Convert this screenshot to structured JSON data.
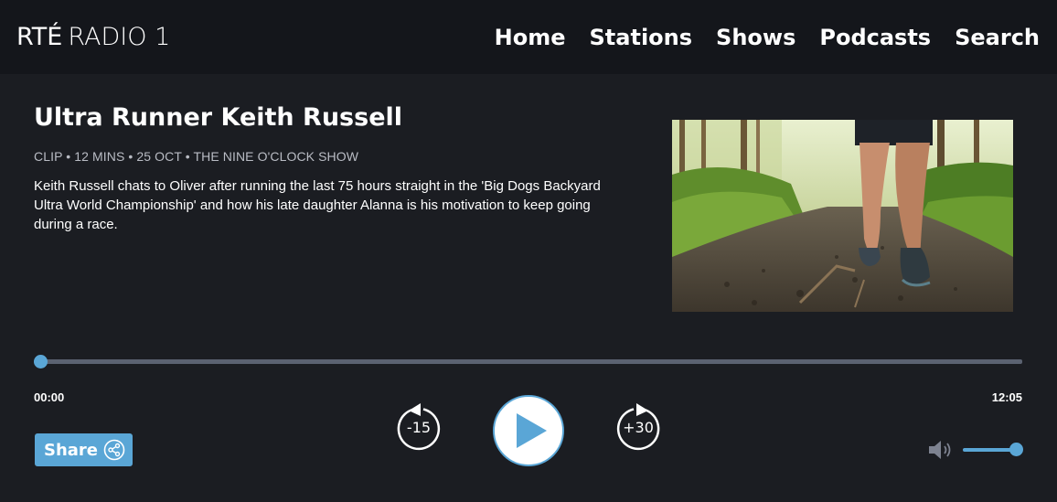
{
  "header": {
    "logo_rte": "RTÉ",
    "logo_station": "RADIO 1",
    "nav": [
      {
        "label": "Home"
      },
      {
        "label": "Stations"
      },
      {
        "label": "Shows"
      },
      {
        "label": "Podcasts"
      },
      {
        "label": "Search"
      }
    ]
  },
  "episode": {
    "title": "Ultra Runner Keith Russell",
    "meta": "CLIP • 12 MINS • 25 OCT • THE NINE O'CLOCK SHOW",
    "description": "Keith Russell chats to Oliver after running the last 75 hours straight in the 'Big Dogs Backyard Ultra World Championship' and how his late daughter Alanna is his motivation to keep going during a race.",
    "image": "trail-runner-feet-photo"
  },
  "player": {
    "current_time": "00:00",
    "total_time": "12:05",
    "progress": 0,
    "skip_back_label": "-15",
    "skip_forward_label": "+30",
    "volume": 1,
    "share_label": "Share",
    "icons": {
      "play": "play-icon",
      "skip_back": "rewind-15-icon",
      "skip_forward": "forward-30-icon",
      "volume": "speaker-icon",
      "share": "share-icon"
    }
  },
  "colors": {
    "accent": "#5aa6d6",
    "background": "#1b1d22",
    "header": "#14161b",
    "track": "#5b6271"
  }
}
